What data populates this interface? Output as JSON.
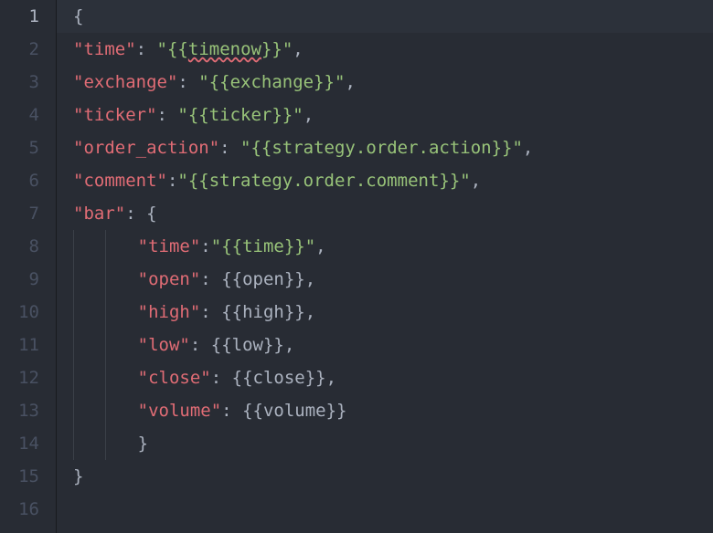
{
  "gutter": {
    "lines": [
      "1",
      "2",
      "3",
      "4",
      "5",
      "6",
      "7",
      "8",
      "9",
      "10",
      "11",
      "12",
      "13",
      "14",
      "15",
      "16"
    ],
    "active_line": 1
  },
  "code": {
    "l01_brace": "{",
    "l02_key": "\"time\"",
    "l02_sep": ": ",
    "l02_q1": "\"",
    "l02_v1a": "{{",
    "l02_v1b": "timenow",
    "l02_v1c": "}}",
    "l02_q2": "\"",
    "l02_end": ",",
    "l03_key": "\"exchange\"",
    "l03_sep": ": ",
    "l03_val": "\"{{exchange}}\"",
    "l03_end": ",",
    "l04_key": "\"ticker\"",
    "l04_sep": ": ",
    "l04_val": "\"{{ticker}}\"",
    "l04_end": ",",
    "l05_key": "\"order_action\"",
    "l05_sep": ": ",
    "l05_val": "\"{{strategy.order.action}}\"",
    "l05_end": ",",
    "l06_key": "\"comment\"",
    "l06_sep": ":",
    "l06_val": "\"{{strategy.order.comment}}\"",
    "l06_end": ",",
    "l07_key": "\"bar\"",
    "l07_sep": ": ",
    "l07_brace": "{",
    "l08_key": "\"time\"",
    "l08_sep": ":",
    "l08_val": "\"{{time}}\"",
    "l08_end": ",",
    "l09_key": "\"open\"",
    "l09_sep": ": ",
    "l09_val": "{{open}}",
    "l09_end": ",",
    "l10_key": "\"high\"",
    "l10_sep": ": ",
    "l10_val": "{{high}}",
    "l10_end": ",",
    "l11_key": "\"low\"",
    "l11_sep": ": ",
    "l11_val": "{{low}}",
    "l11_end": ",",
    "l12_key": "\"close\"",
    "l12_sep": ": ",
    "l12_val": "{{close}}",
    "l12_end": ",",
    "l13_key": "\"volume\"",
    "l13_sep": ": ",
    "l13_val": "{{volume}}",
    "l14_brace": "}",
    "l15_brace": "}"
  }
}
